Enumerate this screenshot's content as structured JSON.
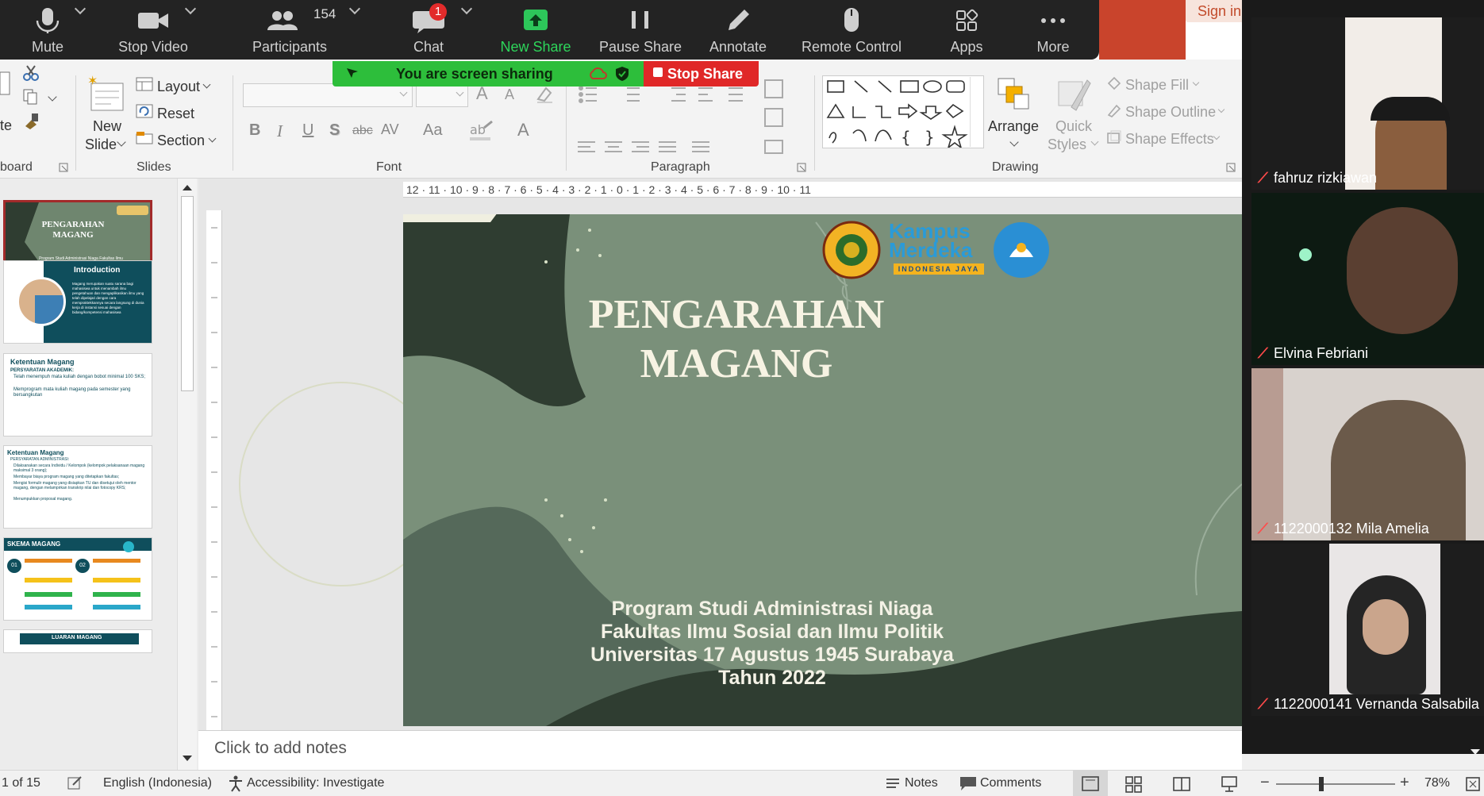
{
  "zoom_toolbar": {
    "mute": "Mute",
    "stop_video": "Stop Video",
    "participants": "Participants",
    "participants_count": "154",
    "chat": "Chat",
    "chat_badge": "1",
    "new_share": "New Share",
    "pause_share": "Pause Share",
    "annotate": "Annotate",
    "remote_control": "Remote Control",
    "apps": "Apps",
    "more": "More"
  },
  "share_banner": {
    "text": "You are screen sharing",
    "stop_label": "Stop Share"
  },
  "signin": "Sign in",
  "ribbon": {
    "clipboard_partial": "te",
    "clipboard_group": "board",
    "new_slide_1": "New",
    "new_slide_2": "Slide",
    "layout": "Layout",
    "reset": "Reset",
    "section": "Section",
    "slides_group": "Slides",
    "font_group": "Font",
    "paragraph_group": "Paragraph",
    "arrange": "Arrange",
    "quick_styles_1": "Quick",
    "quick_styles_2": "Styles",
    "shape_fill": "Shape Fill",
    "shape_outline": "Shape Outline",
    "shape_effects": "Shape Effects",
    "drawing_group": "Drawing",
    "bold": "B",
    "italic": "I",
    "underline": "U",
    "shadow": "S",
    "strike": "abc",
    "spacing": "AV",
    "case": "Aa"
  },
  "ruler": {
    "horizontal": "12 · 11 · 10 · 9 · 8 · 7 · 6 · 5 · 4 · 3 · 2 · 1 · 0 · 1 · 2 · 3 · 4 · 5 · 6 · 7 · 8 · 9 · 10 · 11"
  },
  "thumbnails": [
    {
      "title": "PENGARAHAN MAGANG",
      "sub": "Program Studi Administrasi Niaga Fakultas Ilmu Sosial dan Ilmu Politik Universitas 17 Agustus 1945 Surabaya Tahun 2022"
    },
    {
      "title": "Introduction",
      "sub": "Magang merupakan suatu sarana bagi mahasiswa untuk menambah ilmu pengetahuan dan mengaplikasikan ilmu yang telah dipelajari dengan cara mempraktekkannya secara langsung di dunia kerja di instansi sesuai dengan bidang/kompetensi mahasiswa"
    },
    {
      "title": "Ketentuan Magang",
      "sub1": "PERSYARATAN AKADEMIK:",
      "sub2": "Telah menempuh mata kuliah dengan bobot minimal 100 SKS;",
      "sub3": "Memprogram mata kuliah magang pada semester yang bersangkutan"
    },
    {
      "title": "Ketentuan Magang",
      "sub1": "PERSYARATAN ADMINISTRASI:",
      "sub2": "Dilaksanakan secara Individu / Kelompok (kelompok pelaksanaan magang maksimal 3 orang);",
      "sub3": "Membayar biaya program magang yang ditetapkan fakultas;",
      "sub4": "Mengisi formulir magang yang disiapkan TU dan disetujui oleh mentor magang, dengan melampirkan transkrip nilai dan fotocopy KRS;",
      "sub5": "Menumpukkan proposal magang."
    },
    {
      "title": "SKEMA MAGANG",
      "n1": "01",
      "n2": "02"
    },
    {
      "title": "LUARAN MAGANG"
    }
  ],
  "slide": {
    "title_1": "PENGARAHAN",
    "title_2": "MAGANG",
    "line_1": "Program Studi Administrasi Niaga",
    "line_2": "Fakultas Ilmu Sosial dan Ilmu Politik",
    "line_3": "Universitas 17 Agustus 1945 Surabaya",
    "line_4": "Tahun 2022",
    "logo_kampus": "Kampus",
    "logo_merdeka": "Merdeka",
    "logo_indonesia": "INDONESIA JAYA"
  },
  "notes_placeholder": "Click to add notes",
  "status_bar": {
    "slide_counter": "1 of 15",
    "language": "English (Indonesia)",
    "accessibility": "Accessibility: Investigate",
    "notes": "Notes",
    "comments": "Comments",
    "zoom_level": "78%"
  },
  "participants": [
    {
      "name": "fahruz rizkiawan"
    },
    {
      "name": "Elvina Febriani"
    },
    {
      "name": "1122000132 Mila Amelia"
    },
    {
      "name": "1122000141 Vernanda Salsabila"
    }
  ],
  "colors": {
    "slide_bg": "#7a907a",
    "slide_dark": "#2f3d31",
    "share_green": "#2dbe3b",
    "stop_red": "#e02828"
  }
}
